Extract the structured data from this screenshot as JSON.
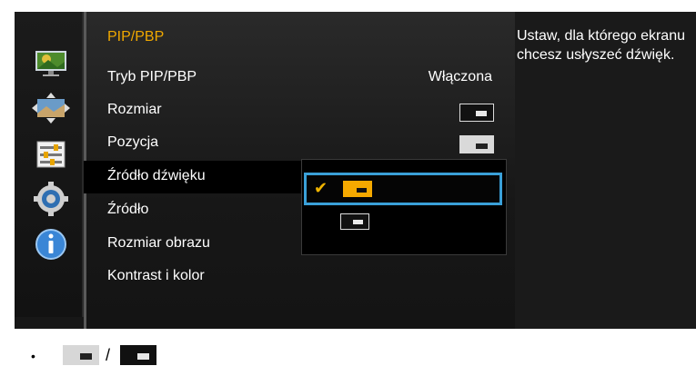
{
  "menu": {
    "title": "PIP/PBP",
    "items": [
      {
        "label": "Tryb PIP/PBP",
        "value": "Włączona"
      },
      {
        "label": "Rozmiar",
        "value": ""
      },
      {
        "label": "Pozycja",
        "value": ""
      },
      {
        "label": "Źródło dźwięku",
        "value": ""
      },
      {
        "label": "Źródło",
        "value": ""
      },
      {
        "label": "Rozmiar obrazu",
        "value": ""
      },
      {
        "label": "Kontrast i kolor",
        "value": ""
      }
    ],
    "selected_item": "Źródło dźwięku"
  },
  "help": {
    "text": "Ustaw, dla którego ekranu chcesz usłyszeć dźwięk."
  },
  "sidebar": {
    "icons": [
      "picture-icon",
      "onscreen-display-icon",
      "sliders-icon",
      "gear-icon",
      "info-icon"
    ]
  },
  "dropdown": {
    "options": [
      {
        "icon": "main-screen-audio-icon",
        "checked": true
      },
      {
        "icon": "sub-screen-audio-icon",
        "checked": false
      }
    ],
    "check_glyph": "✔"
  },
  "legend": {
    "bullet": "•",
    "separator": "/"
  },
  "colors": {
    "accent_title": "#f0a800",
    "focus_border": "#3aa0d8",
    "checked_option": "#f5a900"
  }
}
